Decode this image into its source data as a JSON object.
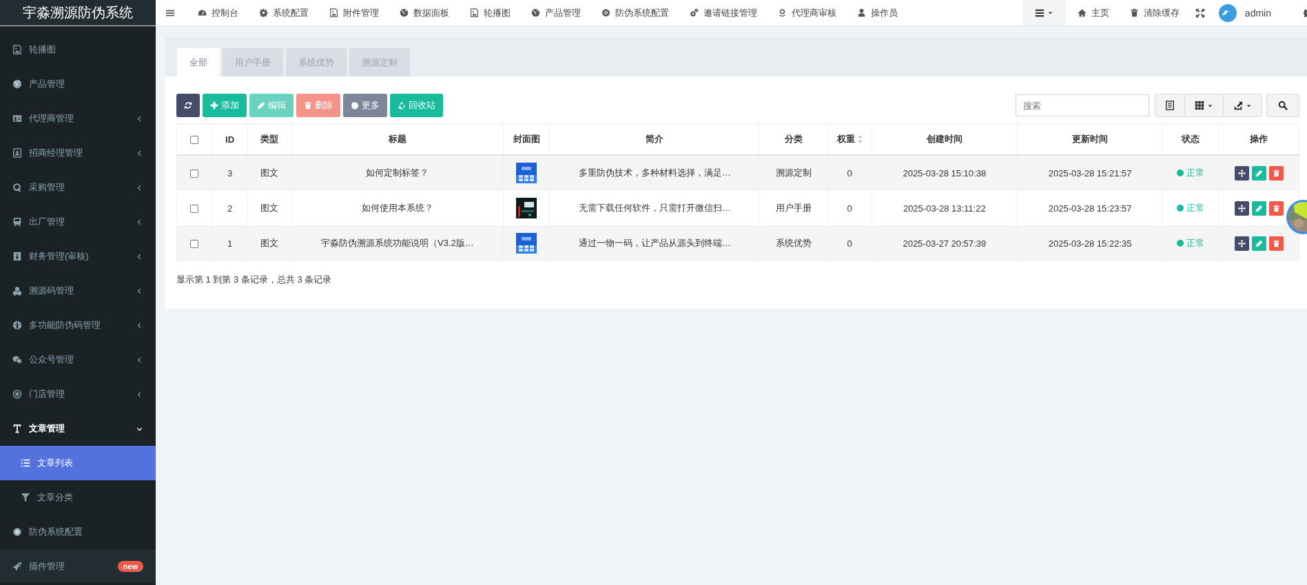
{
  "brand": "宇淼溯源防伪系统",
  "top_nav": [
    {
      "label": "控制台"
    },
    {
      "label": "系统配置"
    },
    {
      "label": "附件管理"
    },
    {
      "label": "数据面板"
    },
    {
      "label": "轮播图"
    },
    {
      "label": "产品管理"
    },
    {
      "label": "防伪系统配置"
    },
    {
      "label": "邀请链接管理"
    },
    {
      "label": "代理商审核"
    },
    {
      "label": "操作员"
    }
  ],
  "top_right": {
    "home": "主页",
    "clear_cache": "清除缓存",
    "user": "admin"
  },
  "sidebar": [
    {
      "label": "轮播图",
      "selected": false
    },
    {
      "label": "产品管理",
      "selected": false
    },
    {
      "label": "代理商管理",
      "selected": false,
      "expanded": false
    },
    {
      "label": "招商经理管理",
      "selected": false,
      "expanded": false
    },
    {
      "label": "采购管理",
      "selected": false,
      "expanded": false
    },
    {
      "label": "出厂管理",
      "selected": false,
      "expanded": false
    },
    {
      "label": "财务管理(审核)",
      "selected": false,
      "expanded": false
    },
    {
      "label": "溯源码管理",
      "selected": false,
      "expanded": false
    },
    {
      "label": "多功能防伪码管理",
      "selected": false,
      "expanded": false
    },
    {
      "label": "公众号管理",
      "selected": false,
      "expanded": false
    },
    {
      "label": "门店管理",
      "selected": false,
      "expanded": false
    },
    {
      "label": "文章管理",
      "selected": false,
      "expanded": true,
      "children": [
        {
          "label": "文章列表",
          "selected": true
        },
        {
          "label": "文章分类",
          "selected": false
        }
      ]
    },
    {
      "label": "防伪系统配置",
      "selected": false
    },
    {
      "label": "插件管理",
      "selected": false,
      "badge": "new"
    }
  ],
  "tabs": [
    {
      "label": "全部",
      "selected": true
    },
    {
      "label": "用户手册",
      "selected": false
    },
    {
      "label": "系统优势",
      "selected": false
    },
    {
      "label": "溯源定制",
      "selected": false
    }
  ],
  "toolbar": [
    {
      "kind": "refresh",
      "disabled": false
    },
    {
      "kind": "add",
      "label": "添加",
      "disabled": false
    },
    {
      "kind": "edit",
      "label": "编辑",
      "disabled": true
    },
    {
      "kind": "delete",
      "label": "删除",
      "disabled": true
    },
    {
      "kind": "more",
      "label": "更多",
      "disabled": false
    },
    {
      "kind": "recycle",
      "label": "回收站",
      "disabled": false
    }
  ],
  "search": {
    "placeholder": "搜索"
  },
  "table": {
    "select_all": {
      "checked": false
    },
    "columns": [
      {
        "label": "ID",
        "sortable": false
      },
      {
        "label": "类型",
        "sortable": false
      },
      {
        "label": "标题",
        "sortable": false
      },
      {
        "label": "封面图",
        "sortable": false
      },
      {
        "label": "简介",
        "sortable": false
      },
      {
        "label": "分类",
        "sortable": false
      },
      {
        "label": "权重",
        "sortable": true
      },
      {
        "label": "创建时间",
        "sortable": false
      },
      {
        "label": "更新时间",
        "sortable": false
      },
      {
        "label": "状态",
        "sortable": false
      },
      {
        "label": "操作",
        "sortable": false
      }
    ],
    "rows": [
      {
        "checked": false,
        "id": "3",
        "type": "图文",
        "title": "如何定制标签？",
        "summary": "多重防伪技术，多种材料选择，满足…",
        "category": "溯源定制",
        "weight": "0",
        "created": "2025-03-28 15:10:38",
        "updated": "2025-03-28 15:21:57",
        "status": "正常"
      },
      {
        "checked": false,
        "id": "2",
        "type": "图文",
        "title": "如何使用本系统？",
        "summary": "无需下载任何软件，只需打开微信扫…",
        "category": "用户手册",
        "weight": "0",
        "created": "2025-03-28 13:11:22",
        "updated": "2025-03-28 15:23:57",
        "status": "正常"
      },
      {
        "checked": false,
        "id": "1",
        "type": "图文",
        "title": "宇淼防伪溯源系统功能说明（V3.2版…",
        "summary": "通过一物一码，让产品从源头到终端…",
        "category": "系统优势",
        "weight": "0",
        "created": "2025-03-27 20:57:39",
        "updated": "2025-03-28 15:22:35",
        "status": "正常"
      }
    ]
  },
  "pagination_info": "显示第 1 到第 3 条记录，总共 3 条记录"
}
